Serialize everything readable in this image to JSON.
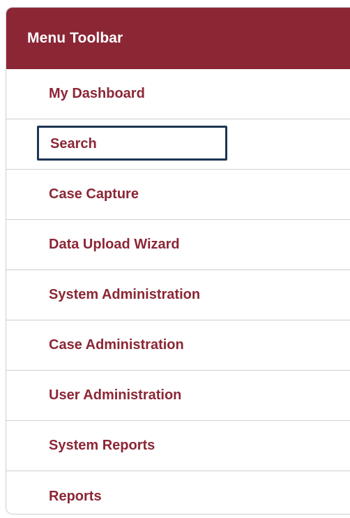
{
  "menu": {
    "title": "Menu Toolbar",
    "accent_color": "#8b2635",
    "focus_color": "#1c3553",
    "focused_item": "Search",
    "items": [
      {
        "label": "My Dashboard"
      },
      {
        "label": "Search"
      },
      {
        "label": "Case Capture"
      },
      {
        "label": "Data Upload Wizard"
      },
      {
        "label": "System Administration"
      },
      {
        "label": "Case Administration"
      },
      {
        "label": "User Administration"
      },
      {
        "label": "System Reports"
      },
      {
        "label": "Reports"
      }
    ]
  }
}
